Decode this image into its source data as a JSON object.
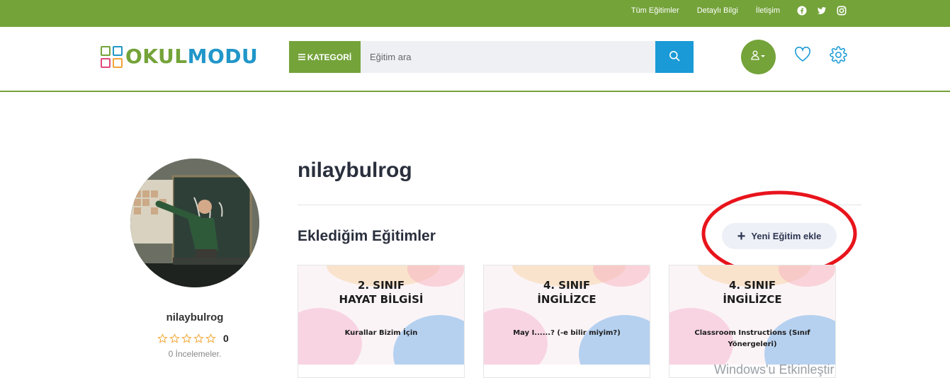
{
  "topbar": {
    "links": [
      "Tüm Eğitimler",
      "Detaylı Bilgi",
      "İletişim"
    ],
    "social": [
      "facebook-icon",
      "twitter-icon",
      "instagram-icon"
    ],
    "color": "#74a33a"
  },
  "header": {
    "logo_part1": "OKUL",
    "logo_part2": "MODU",
    "category_label": "KATEGORİ",
    "search_placeholder": "Eğitim ara",
    "accent": "#74a33a",
    "search_button_color": "#1a9ad6"
  },
  "profile": {
    "title": "nilaybulrog",
    "side_name": "nilaybulrog",
    "rating": "0",
    "reviews": "0 İncelemeler."
  },
  "section": {
    "title": "Eklediğim Eğitimler",
    "add_button": "Yeni Eğitim ekle"
  },
  "cards": [
    {
      "grade": "2. SINIF",
      "subject": "HAYAT BİLGİSİ",
      "topic": "Kurallar Bizim İçin"
    },
    {
      "grade": "4. SINIF",
      "subject": "İNGİLİZCE",
      "topic": "May I......? (-e bilir miyim?)"
    },
    {
      "grade": "4. SINIF",
      "subject": "İNGİLİZCE",
      "topic": "Classroom Instructions (Sınıf Yönergeleri)"
    }
  ],
  "watermark": "Windows'u Etkinleştir"
}
